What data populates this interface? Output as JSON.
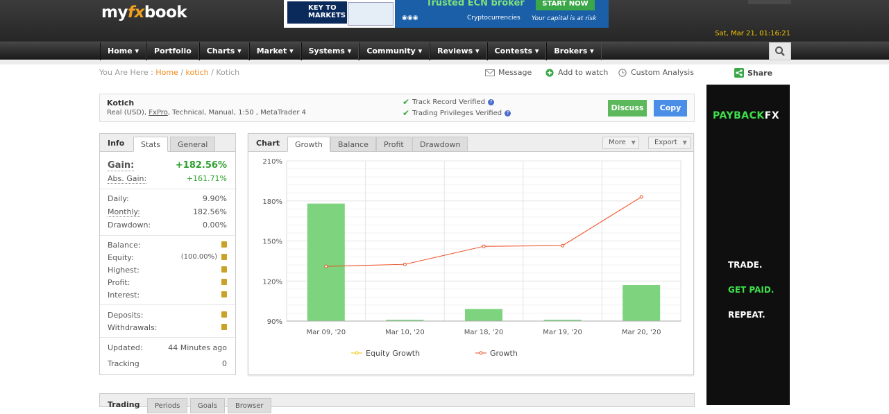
{
  "header": {
    "logo_prefix": "my",
    "logo_fx": "fx",
    "logo_suffix": "book",
    "datetime": "Sat, Mar 21, 01:16:21",
    "banner": {
      "brand": "KEY TO MARKETS",
      "headline": "Trusted ECN broker",
      "cta": "START NOW",
      "crypto": "Cryptocurrencies",
      "risk": "Your capital is at risk"
    }
  },
  "nav": {
    "items": [
      "Home ▾",
      "Portfolio",
      "Charts ▾",
      "Market ▾",
      "Systems ▾",
      "Community ▾",
      "Reviews ▾",
      "Contests ▾",
      "Brokers ▾"
    ]
  },
  "breadcrumb": {
    "prefix": "You Are Here :",
    "home": "Home",
    "sep1": "/",
    "user": "kotich",
    "sep2": "/",
    "current": "Kotich"
  },
  "actions": {
    "message": "Message",
    "watch": "Add to watch",
    "analysis": "Custom Analysis",
    "share": "Share"
  },
  "account": {
    "name": "Kotich",
    "desc_pre": "Real (USD),",
    "broker": "FxPro",
    "desc_post": ", Technical, Manual, 1:50 , MetaTrader 4",
    "track": "Track Record Verified",
    "privileges": "Trading Privileges Verified",
    "discuss": "Discuss",
    "copy": "Copy"
  },
  "info": {
    "title": "Info",
    "tabs": [
      "Stats",
      "General"
    ],
    "gain_label": "Gain:",
    "gain_value": "+182.56%",
    "abs_label": "Abs. Gain:",
    "abs_value": "+161.71%",
    "daily_label": "Daily:",
    "daily_value": "9.90%",
    "monthly_label": "Monthly:",
    "monthly_value": "182.56%",
    "drawdown_label": "Drawdown:",
    "drawdown_value": "0.00%",
    "balance_label": "Balance:",
    "equity_label": "Equity:",
    "equity_value": "(100.00%)",
    "highest_label": "Highest:",
    "profit_label": "Profit:",
    "interest_label": "Interest:",
    "deposits_label": "Deposits:",
    "withdrawals_label": "Withdrawals:",
    "updated_label": "Updated:",
    "updated_value": "44 Minutes ago",
    "tracking_label": "Tracking",
    "tracking_value": "0"
  },
  "chart_panel": {
    "title": "Chart",
    "tabs": [
      "Growth",
      "Balance",
      "Profit",
      "Drawdown"
    ],
    "more": "More",
    "export": "Export"
  },
  "chart_data": {
    "type": "bar",
    "categories": [
      "Mar 09, '20",
      "Mar 10, '20",
      "Mar 18, '20",
      "Mar 19, '20",
      "Mar 20, '20"
    ],
    "y_ticks": [
      "90%",
      "120%",
      "150%",
      "180%",
      "210%"
    ],
    "ylim": [
      90,
      210
    ],
    "series": [
      {
        "name": "Equity Growth",
        "type": "bar",
        "values": [
          178,
          91,
          99,
          91,
          117
        ],
        "color": "#7ed37e"
      },
      {
        "name": "Growth",
        "type": "line",
        "values": [
          131,
          132.5,
          146,
          146.5,
          183
        ],
        "color": "#ee4a1f"
      }
    ],
    "legend": [
      "Equity Growth",
      "Growth"
    ],
    "legend_placement": "bottom"
  },
  "ad": {
    "brand": "PAYBACK",
    "brand_fx": "FX",
    "line1": "TRADE.",
    "line2": "GET PAID.",
    "line3": "REPEAT."
  },
  "trading": {
    "title": "Trading",
    "tabs": [
      "Periods",
      "Goals",
      "Browser"
    ]
  }
}
